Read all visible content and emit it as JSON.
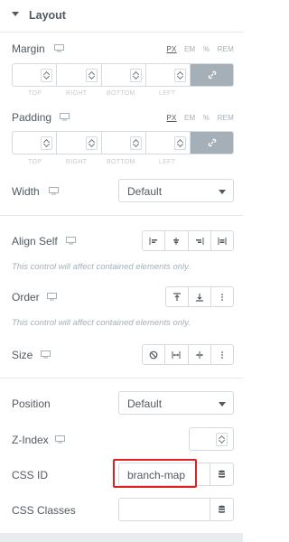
{
  "header": {
    "title": "Layout"
  },
  "margin": {
    "label": "Margin",
    "units": [
      "PX",
      "EM",
      "%",
      "REM"
    ],
    "active_unit": "PX",
    "sublabels": [
      "TOP",
      "RIGHT",
      "BOTTOM",
      "LEFT"
    ]
  },
  "padding": {
    "label": "Padding",
    "units": [
      "PX",
      "EM",
      "%",
      "REM"
    ],
    "active_unit": "PX",
    "sublabels": [
      "TOP",
      "RIGHT",
      "BOTTOM",
      "LEFT"
    ]
  },
  "width": {
    "label": "Width",
    "value": "Default"
  },
  "align_self": {
    "label": "Align Self",
    "note": "This control will affect contained elements only."
  },
  "order": {
    "label": "Order",
    "note": "This control will affect contained elements only."
  },
  "size": {
    "label": "Size"
  },
  "position": {
    "label": "Position",
    "value": "Default"
  },
  "zindex": {
    "label": "Z-Index"
  },
  "css_id": {
    "label": "CSS ID",
    "value": "branch-map"
  },
  "css_classes": {
    "label": "CSS Classes",
    "value": ""
  },
  "colors": {
    "link_active": "#a4afb7",
    "highlight": "#e02020",
    "text": "#515962"
  }
}
